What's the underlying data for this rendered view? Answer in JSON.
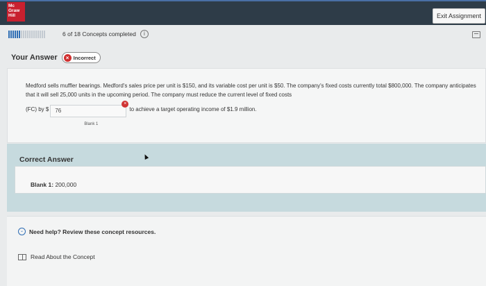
{
  "header": {
    "logo_lines": [
      "Mc",
      "Graw",
      "Hill"
    ],
    "exit_label": "Exit Assignment"
  },
  "progress": {
    "completed": 6,
    "total": 18,
    "text": "6 of 18 Concepts completed",
    "info_symbol": "i"
  },
  "your_answer": {
    "label": "Your Answer",
    "status": "Incorrect",
    "status_symbol": "×"
  },
  "question": {
    "text": "Medford sells muffler bearings. Medford's sales price per unit is $150, and its variable cost per unit is $50. The company's fixed costs currently total $800,000. The company anticipates that it will sell 25,000 units in the upcoming period. The company must reduce the current level of fixed costs",
    "prefix": "(FC) by $",
    "blank_value": "76",
    "blank_caption": "Blank 1",
    "blank_symbol": "×",
    "suffix": "to achieve a target operating income of $1.9 million."
  },
  "correct_answer": {
    "title": "Correct Answer",
    "blank_label": "Blank 1:",
    "blank_value": "200,000"
  },
  "help": {
    "chevron_symbol": "⌄",
    "label": "Need help? Review these concept resources.",
    "resource_label": "Read About the Concept"
  },
  "colors": {
    "topbar": "#2e3c48",
    "logo": "#c8202f",
    "progress_done": "#2e6db4",
    "incorrect": "#d02f2f",
    "correct_section": "#c6dade"
  },
  "icons": [
    "info-icon",
    "print-icon",
    "incorrect-x-icon",
    "chevron-down-icon",
    "book-icon"
  ]
}
